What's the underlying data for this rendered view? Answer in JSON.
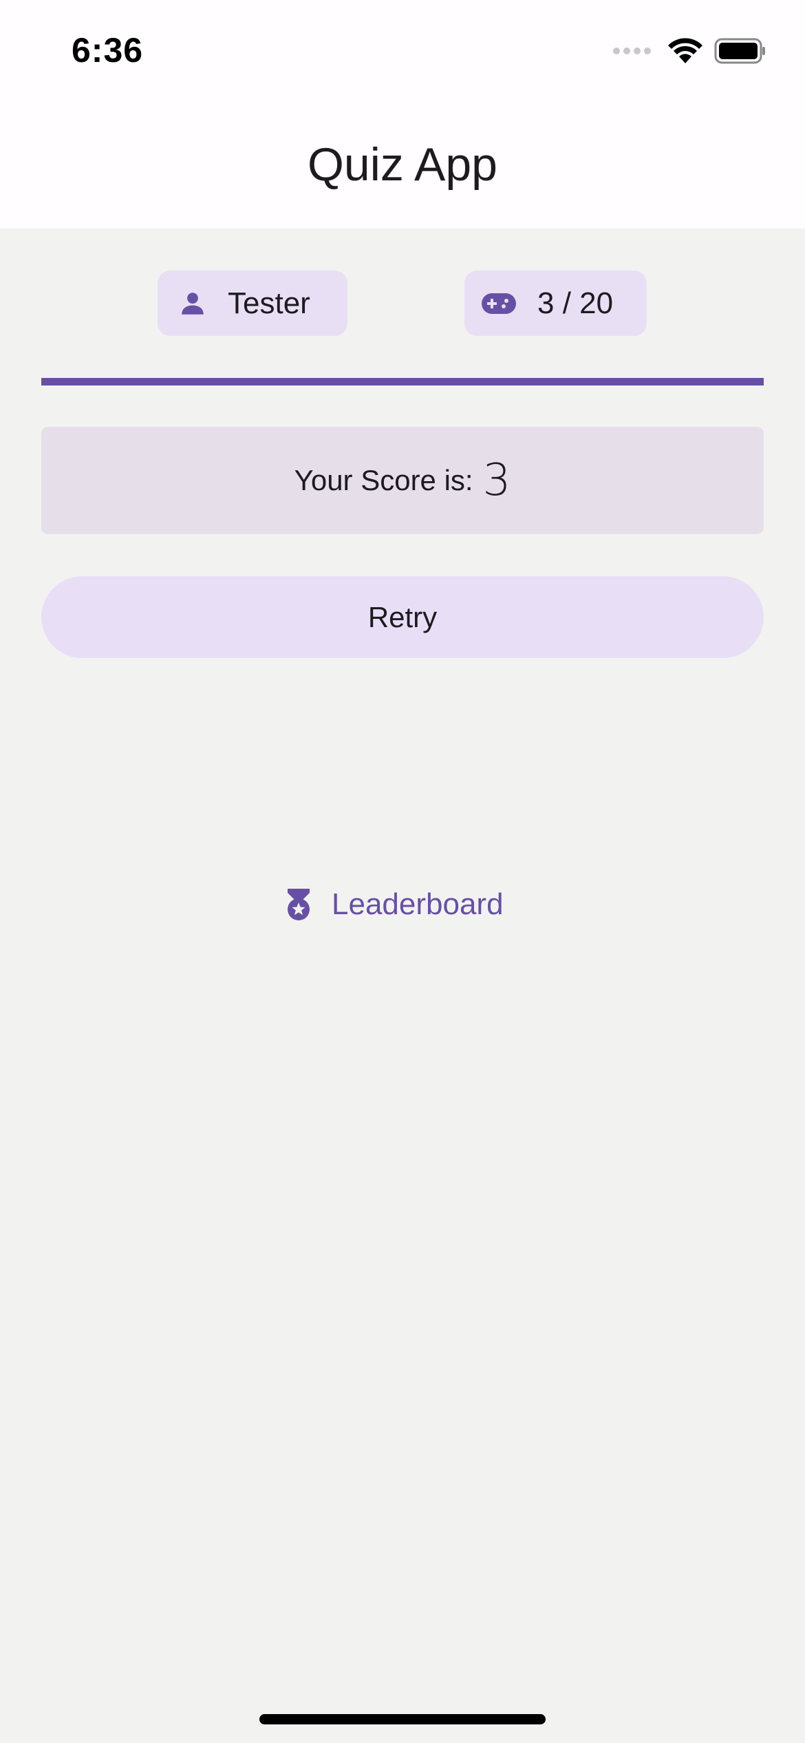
{
  "status_bar": {
    "time": "6:36",
    "icons": [
      "cellular-signal-icon",
      "wifi-icon",
      "battery-icon"
    ]
  },
  "app_bar": {
    "title": "Quiz App"
  },
  "player_chip": {
    "icon": "person-icon",
    "label": "Tester"
  },
  "progress_chip": {
    "icon": "gamepad-icon",
    "label": "3 / 20"
  },
  "progress_bar": {
    "value": 1.0
  },
  "score_card": {
    "label": "Your Score is:",
    "value": "3"
  },
  "retry_button": {
    "label": "Retry"
  },
  "leaderboard_link": {
    "icon": "medal-icon",
    "label": "Leaderboard"
  },
  "colors": {
    "primary": "#6750a4",
    "chip_background": "#e8dff5",
    "page_background": "#f2f3f1",
    "app_bar_background": "#fffdff",
    "score_card_background": "#e6dfe9"
  }
}
